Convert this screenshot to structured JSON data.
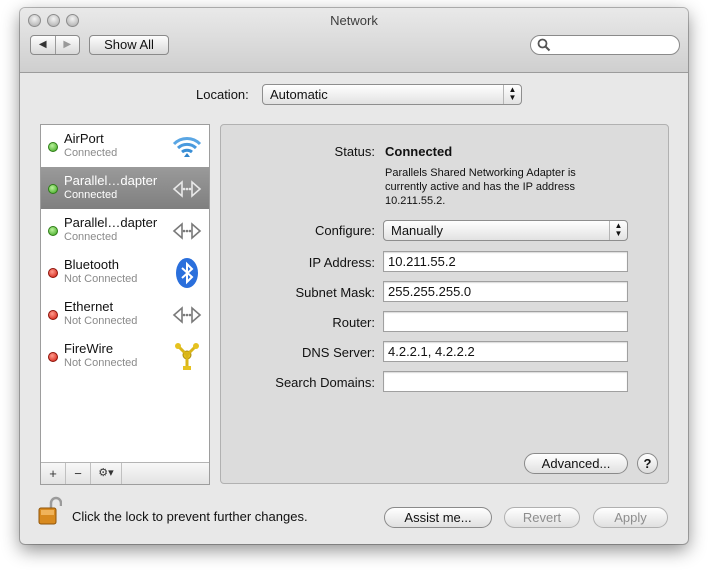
{
  "window": {
    "title": "Network"
  },
  "toolbar": {
    "back_label": "◀",
    "forward_label": "▶",
    "show_all_label": "Show All",
    "search_placeholder": ""
  },
  "location": {
    "label": "Location:",
    "value": "Automatic"
  },
  "services": [
    {
      "name": "AirPort",
      "status": "Connected",
      "status_color": "green",
      "icon": "wifi-icon",
      "selected": false
    },
    {
      "name": "Parallel…dapter",
      "status": "Connected",
      "status_color": "green",
      "icon": "ethernet-arrows-icon",
      "selected": true
    },
    {
      "name": "Parallel…dapter",
      "status": "Connected",
      "status_color": "green",
      "icon": "ethernet-arrows-icon",
      "selected": false
    },
    {
      "name": "Bluetooth",
      "status": "Not Connected",
      "status_color": "red",
      "icon": "bluetooth-icon",
      "selected": false
    },
    {
      "name": "Ethernet",
      "status": "Not Connected",
      "status_color": "red",
      "icon": "ethernet-arrows-icon",
      "selected": false
    },
    {
      "name": "FireWire",
      "status": "Not Connected",
      "status_color": "red",
      "icon": "firewire-icon",
      "selected": false
    }
  ],
  "sidebar_controls": {
    "add": "+",
    "remove": "−",
    "gear": "⚙▾"
  },
  "detail": {
    "status_label": "Status:",
    "status_value": "Connected",
    "status_description": "Parallels Shared Networking Adapter is currently active and has the IP address 10.211.55.2.",
    "configure_label": "Configure:",
    "configure_value": "Manually",
    "ip_label": "IP Address:",
    "ip_value": "10.211.55.2",
    "subnet_label": "Subnet Mask:",
    "subnet_value": "255.255.255.0",
    "router_label": "Router:",
    "router_value": "",
    "dns_label": "DNS Server:",
    "dns_value": "4.2.2.1, 4.2.2.2",
    "search_domains_label": "Search Domains:",
    "search_domains_value": "",
    "advanced_label": "Advanced...",
    "help_label": "?"
  },
  "footer": {
    "lock_text": "Click the lock to prevent further changes.",
    "assist_label": "Assist me...",
    "revert_label": "Revert",
    "apply_label": "Apply"
  },
  "colors": {
    "selection": "#8a8a8a",
    "status_green": "#3ba51d",
    "status_red": "#d11a0d",
    "wifi_blue": "#3a8fd6",
    "bluetooth_blue": "#2a6fdc"
  }
}
